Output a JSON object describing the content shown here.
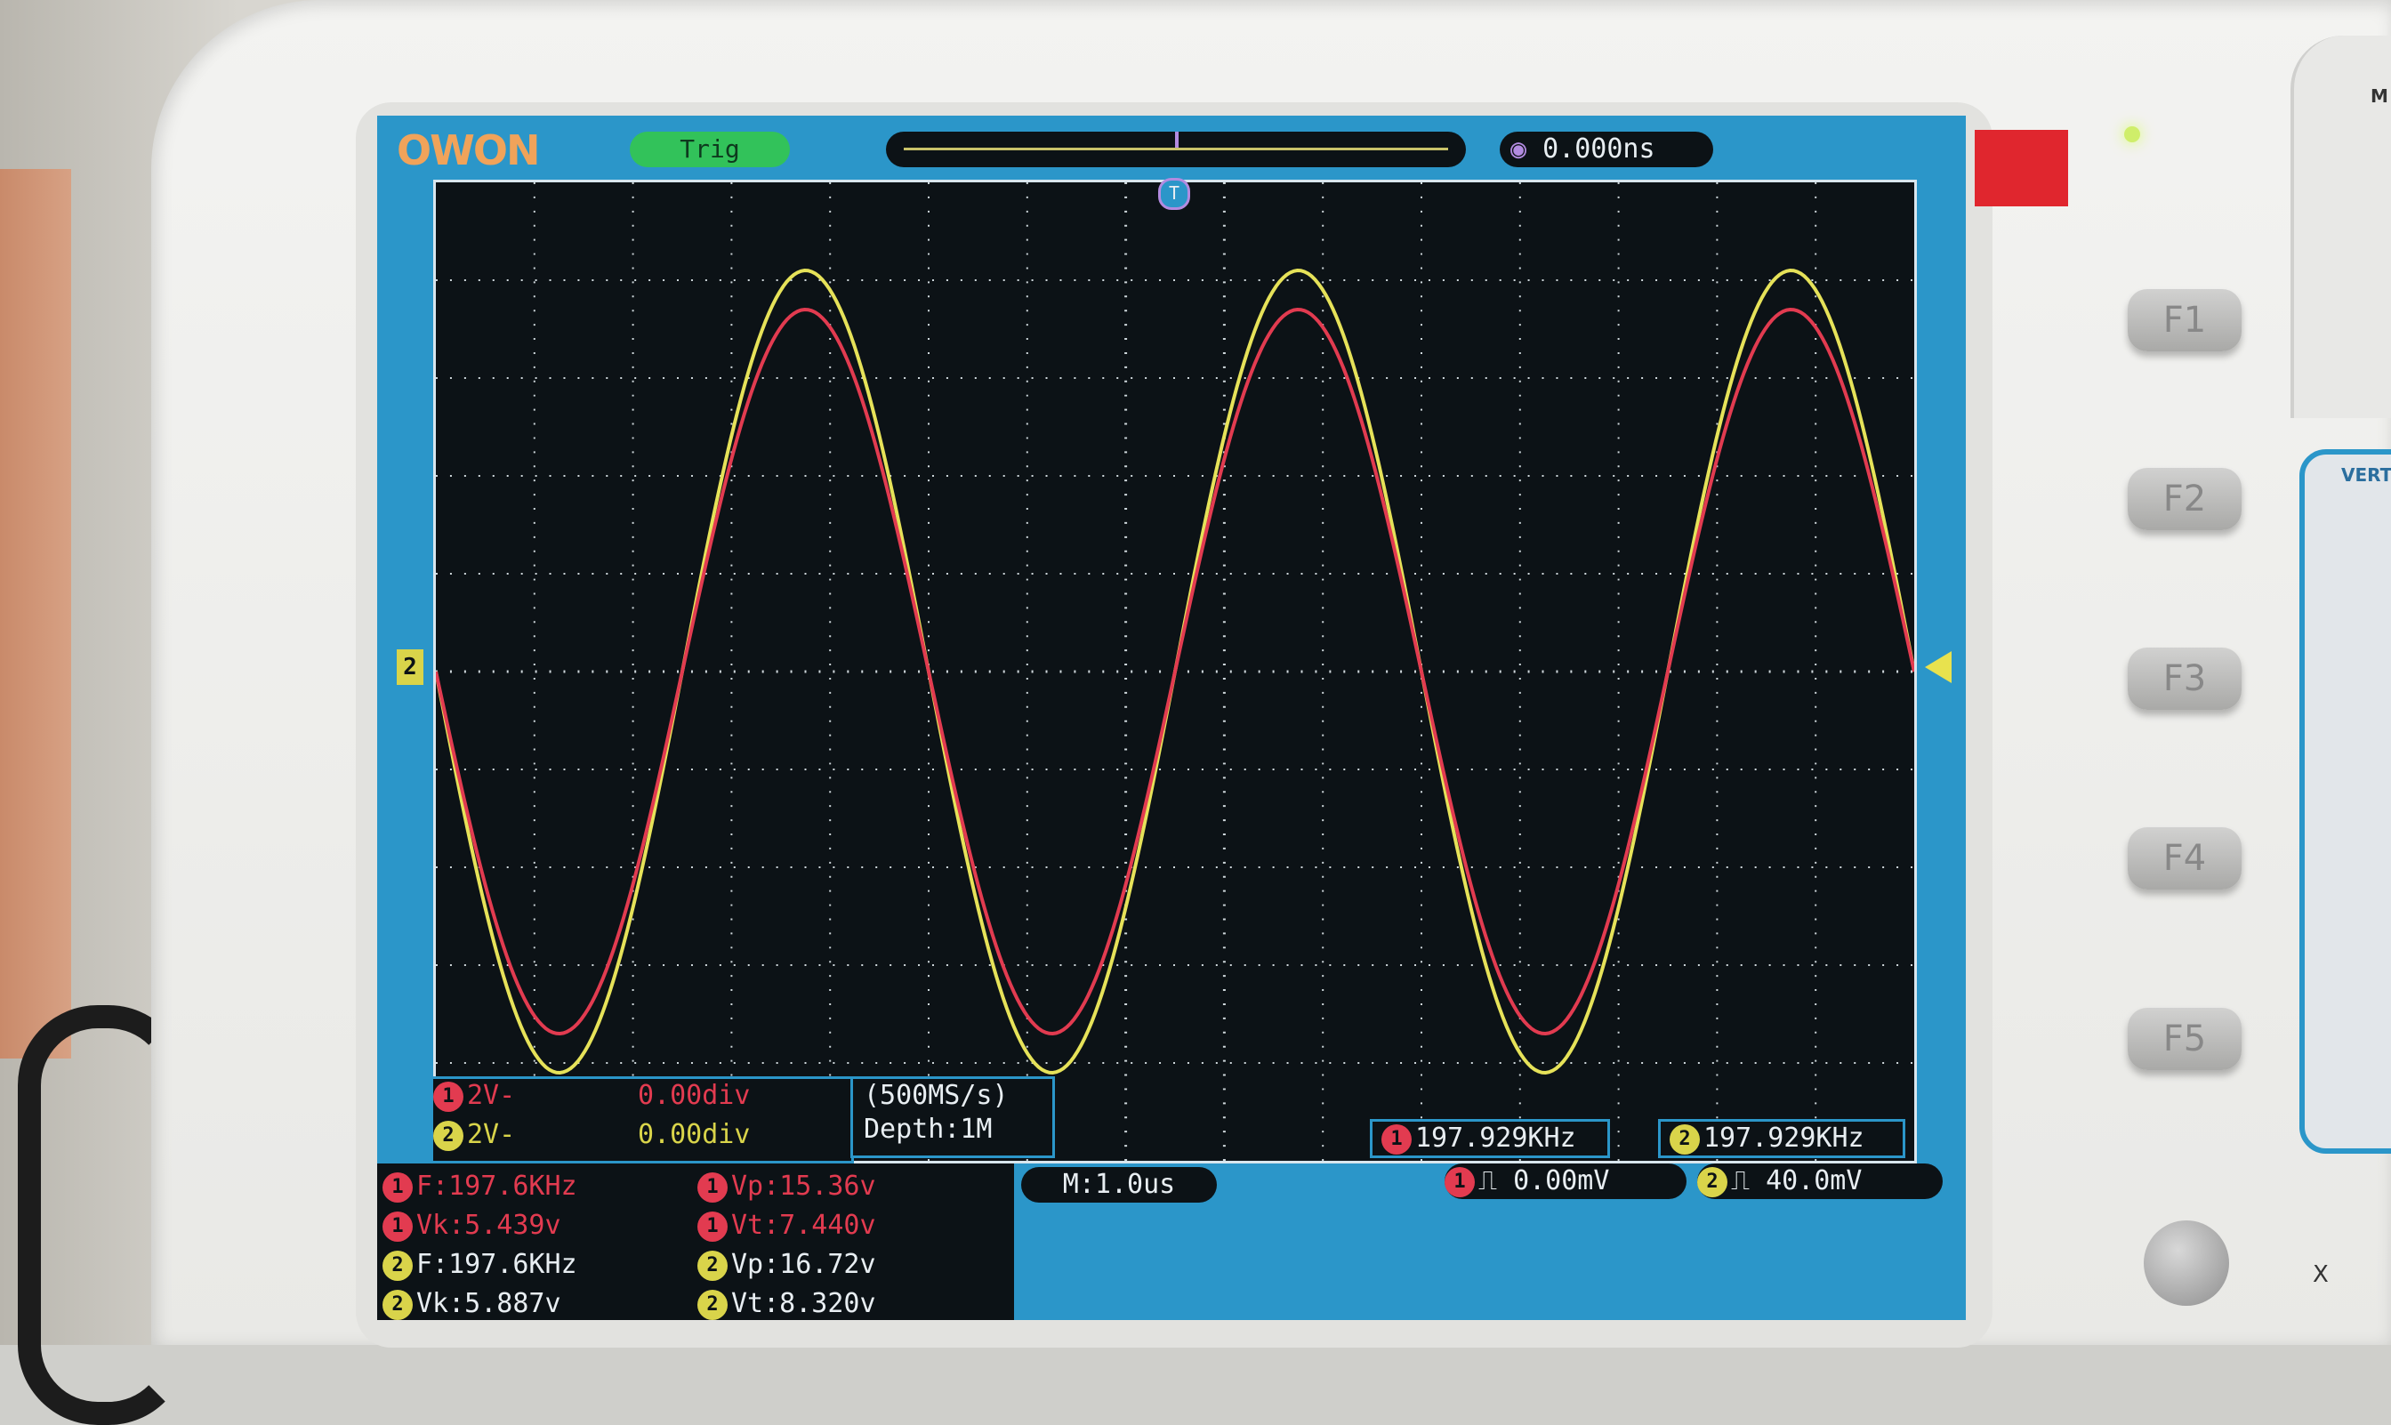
{
  "brand": "OWON",
  "trigger_status": "Trig",
  "time_offset": "0.000ns",
  "trigger_pos_marker": "T",
  "ch2_ground_marker": "2",
  "channels": [
    {
      "badge": "1",
      "scale": "2V-",
      "offset": "0.00div"
    },
    {
      "badge": "2",
      "scale": "2V-",
      "offset": "0.00div"
    }
  ],
  "sample_rate": "(500MS/s)",
  "depth": "Depth:1M",
  "freq_counters": [
    {
      "badge": "1",
      "value": "197.929KHz"
    },
    {
      "badge": "2",
      "value": "197.929KHz"
    }
  ],
  "measurements": {
    "ch1_f": "F:197.6KHz",
    "ch1_vk": "Vk:5.439v",
    "ch1_vp": "Vp:15.36v",
    "ch1_vt": "Vt:7.440v",
    "ch2_f": "F:197.6KHz",
    "ch2_vk": "Vk:5.887v",
    "ch2_vp": "Vp:16.72v",
    "ch2_vt": "Vt:8.320v",
    "badge1": "1",
    "badge2": "2"
  },
  "timebase": "M:1.0us",
  "triggers": [
    {
      "badge": "1",
      "symbol": "⎍",
      "level": "0.00mV"
    },
    {
      "badge": "2",
      "symbol": "⎍",
      "level": "40.0mV"
    }
  ],
  "function_keys": [
    "F1",
    "F2",
    "F3",
    "F4",
    "F5"
  ],
  "vertical_label": "VERT",
  "x_label": "X",
  "panel_corner_label": "M",
  "colors": {
    "ch1": "#e23b50",
    "ch2": "#d9d44a",
    "screen_frame": "#2b96c9",
    "grid_bg": "#0c1216"
  },
  "waveforms": {
    "cycles_on_screen": 3,
    "ch1_amplitude_div": 3.7,
    "ch2_amplitude_div": 4.1,
    "start_phase": "falling"
  }
}
